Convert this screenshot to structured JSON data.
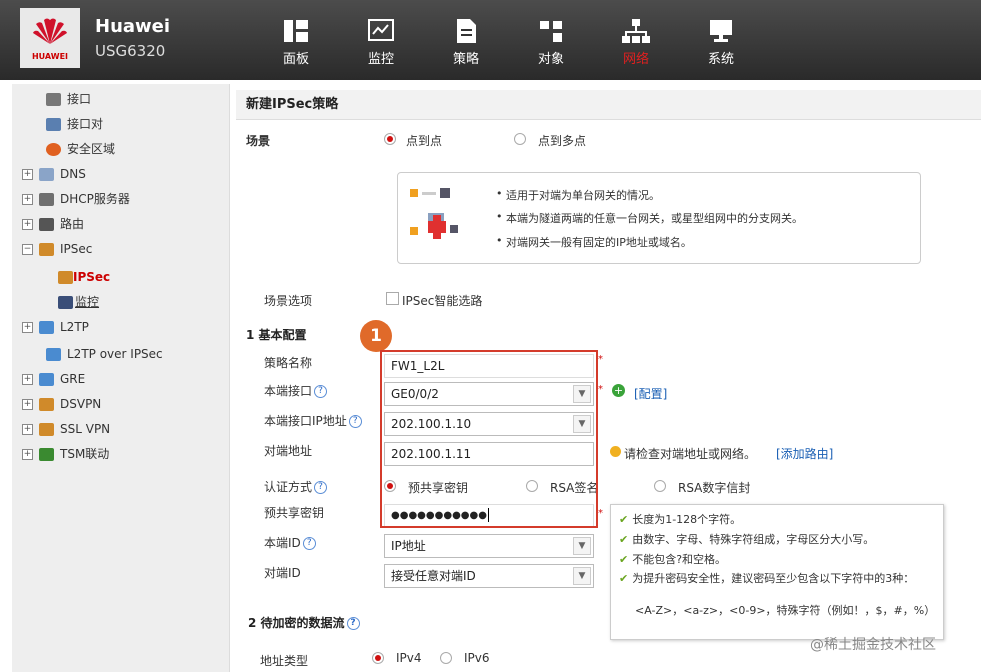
{
  "header": {
    "brand_text": "HUAWEI",
    "product": "Huawei",
    "model": "USG6320",
    "nav": [
      {
        "label": "面板",
        "icon": "dashboard-icon"
      },
      {
        "label": "监控",
        "icon": "monitor-icon"
      },
      {
        "label": "策略",
        "icon": "policy-icon"
      },
      {
        "label": "对象",
        "icon": "object-icon"
      },
      {
        "label": "网络",
        "icon": "network-icon",
        "active": true
      },
      {
        "label": "系统",
        "icon": "system-icon"
      }
    ]
  },
  "sidebar": {
    "items": [
      {
        "label": "接口",
        "icon": "interface-icon"
      },
      {
        "label": "接口对",
        "icon": "interface-pair-icon"
      },
      {
        "label": "安全区域",
        "icon": "security-zone-icon"
      },
      {
        "label": "DNS",
        "icon": "dns-icon",
        "expand": "+"
      },
      {
        "label": "DHCP服务器",
        "icon": "dhcp-icon",
        "expand": "+"
      },
      {
        "label": "路由",
        "icon": "route-icon",
        "expand": "+"
      },
      {
        "label": "IPSec",
        "icon": "ipsec-icon",
        "expand": "−"
      },
      {
        "label": "IPSec",
        "icon": "ipsec-policy-icon",
        "selected": true
      },
      {
        "label": "监控",
        "icon": "ipsec-monitor-icon"
      },
      {
        "label": "L2TP",
        "icon": "l2tp-icon",
        "expand": "+"
      },
      {
        "label": "L2TP over IPSec",
        "icon": "l2tp-ipsec-icon"
      },
      {
        "label": "GRE",
        "icon": "gre-icon",
        "expand": "+"
      },
      {
        "label": "DSVPN",
        "icon": "dsvpn-icon",
        "expand": "+"
      },
      {
        "label": "SSL VPN",
        "icon": "sslvpn-icon",
        "expand": "+"
      },
      {
        "label": "TSM联动",
        "icon": "tsm-icon",
        "expand": "+"
      }
    ]
  },
  "main": {
    "title": "新建IPSec策略",
    "scenario": {
      "label": "场景",
      "options": [
        "点到点",
        "点到多点"
      ],
      "selected": "点到点",
      "info": [
        "适用于对端为单台网关的情况。",
        "本端为隧道两端的任意一台网关，或星型组网中的分支网关。",
        "对端网关一般有固定的IP地址或域名。"
      ]
    },
    "scenario_option": {
      "label": "场景选项",
      "checkbox": "IPSec智能选路"
    },
    "section1": "1 基本配置",
    "badge": "1",
    "fields": {
      "policy_name": {
        "label": "策略名称",
        "value": "FW1_L2L"
      },
      "local_interface": {
        "label": "本端接口",
        "value": "GE0/0/2",
        "link": "[配置]"
      },
      "local_ip": {
        "label": "本端接口IP地址",
        "value": "202.100.1.10"
      },
      "peer_address": {
        "label": "对端地址",
        "value": "202.100.1.11",
        "hint": "请检查对端地址或网络。",
        "link": "[添加路由]"
      },
      "auth_method": {
        "label": "认证方式",
        "options": [
          "预共享密钥",
          "RSA签名",
          "RSA数字信封"
        ],
        "selected": "预共享密钥"
      },
      "psk": {
        "label": "预共享密钥",
        "value": "●●●●●●●●●●●"
      },
      "local_id": {
        "label": "本端ID",
        "value": "IP地址"
      },
      "peer_id": {
        "label": "对端ID",
        "value": "接受任意对端ID"
      }
    },
    "tooltip": [
      "长度为1-128个字符。",
      "由数字、字母、特殊字符组成，字母区分大小写。",
      "不能包含?和空格。",
      "为提升密码安全性，建议密码至少包含以下字符中的3种：",
      "<A-Z>，<a-z>，<0-9>，特殊字符（例如！，$，#，%）"
    ],
    "section2": "2 待加密的数据流",
    "addr_type": {
      "label": "地址类型",
      "options": [
        "IPv4",
        "IPv6"
      ],
      "selected": "IPv4"
    }
  },
  "watermark": "@稀土掘金技术社区",
  "colors": {
    "accent": "#d01010",
    "badge": "#e06a2a",
    "redbox": "#d43b2b"
  }
}
